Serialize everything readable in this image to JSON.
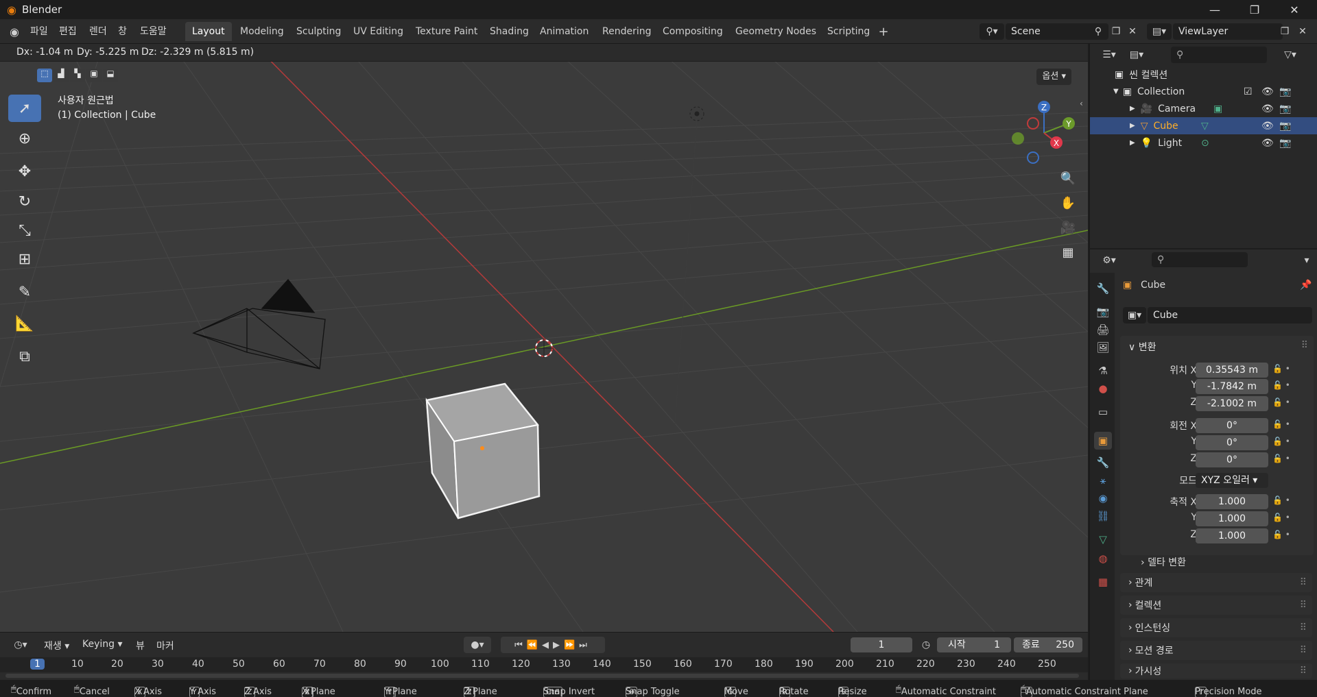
{
  "app": {
    "title": "Blender"
  },
  "menu": [
    "파일",
    "편집",
    "렌더",
    "창",
    "도움말"
  ],
  "workspaces": [
    "Layout",
    "Modeling",
    "Sculpting",
    "UV Editing",
    "Texture Paint",
    "Shading",
    "Animation",
    "Rendering",
    "Compositing",
    "Geometry Nodes",
    "Scripting"
  ],
  "active_workspace": "Layout",
  "scene": {
    "value": "Scene"
  },
  "view_layer": {
    "value": "ViewLayer"
  },
  "viewport": {
    "header_status": {
      "dx": "Dx: -1.04 m",
      "dy": "Dy: -5.225 m",
      "dz": "Dz: -2.329 m (5.815 m)"
    },
    "view_name": "사용자 원근법",
    "view_context": "(1) Collection | Cube",
    "options_label": "옵션",
    "gizmo": {
      "x": "X",
      "y": "Y",
      "z": "Z"
    }
  },
  "outliner": {
    "scene_collection": "씬 컬렉션",
    "collection": "Collection",
    "objects": [
      {
        "name": "Camera",
        "selected": false
      },
      {
        "name": "Cube",
        "selected": true
      },
      {
        "name": "Light",
        "selected": false
      }
    ]
  },
  "properties": {
    "object_name": "Cube",
    "object_field": "Cube",
    "transform_header": "변환",
    "location_label": "위치 X",
    "location": {
      "x": "0.35543 m",
      "y": "-1.7842 m",
      "z": "-2.1002 m"
    },
    "rotation_label": "회전 X",
    "rotation": {
      "x": "0°",
      "y": "0°",
      "z": "0°"
    },
    "mode_label": "모드",
    "mode_value": "XYZ 오일러",
    "scale_label": "축적 X",
    "scale": {
      "x": "1.000",
      "y": "1.000",
      "z": "1.000"
    },
    "axis_y": "Y",
    "axis_z": "Z",
    "delta_transform": "델타 변환",
    "panels": [
      "관계",
      "컬렉션",
      "인스턴싱",
      "모션 경로",
      "가시성"
    ]
  },
  "timeline": {
    "playback": "재생",
    "keying": "Keying",
    "view": "뷰",
    "marker": "마커",
    "current_frame": "1",
    "start_label": "시작",
    "start": "1",
    "end_label": "종료",
    "end": "250",
    "ruler": [
      "1",
      "10",
      "20",
      "30",
      "40",
      "50",
      "60",
      "70",
      "80",
      "90",
      "100",
      "110",
      "120",
      "130",
      "140",
      "150",
      "160",
      "170",
      "180",
      "190",
      "200",
      "210",
      "220",
      "230",
      "240",
      "250"
    ]
  },
  "statusbar": {
    "confirm": "Confirm",
    "cancel": "Cancel",
    "x_axis": "X Axis",
    "y_axis": "Y Axis",
    "z_axis": "Z Axis",
    "x_plane": "X Plane",
    "y_plane": "Y Plane",
    "z_plane": "Z Plane",
    "snap_invert": "Snap Invert",
    "snap_toggle": "Snap Toggle",
    "move": "Move",
    "rotate": "Rotate",
    "resize": "Resize",
    "auto_constraint": "Automatic Constraint",
    "auto_constraint_plane": "Automatic Constraint Plane",
    "precision": "Precision Mode",
    "keys": {
      "x": "X",
      "y": "Y",
      "z": "Z",
      "ctrl": "Ctrl",
      "g": "G",
      "r": "R",
      "s": "S"
    }
  },
  "colors": {
    "accent": "#4772b3",
    "selected_text": "#ffaf29",
    "x_axis": "#c23b3b",
    "y_axis": "#6b9a2a",
    "z_axis": "#3b6fc2"
  }
}
